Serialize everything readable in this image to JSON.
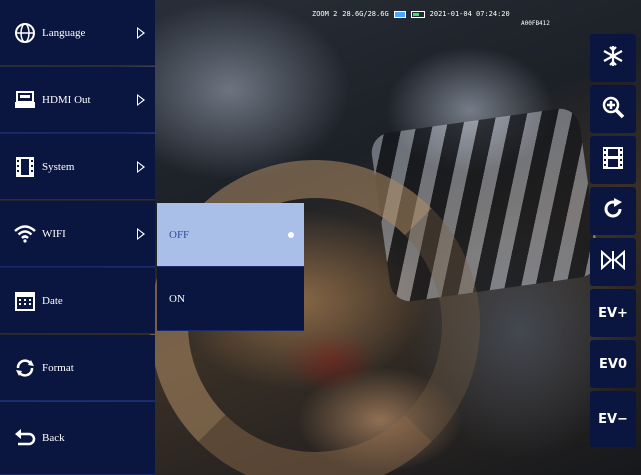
{
  "status": {
    "zoom": "ZOOM 2",
    "storage": "28.6G/28.6G",
    "datetime": "2021-01-04 07:24:20",
    "sub": "A00FB412"
  },
  "menu": {
    "items": [
      {
        "label": "Language",
        "icon": "globe-icon",
        "has_submenu": true
      },
      {
        "label": "HDMI Out",
        "icon": "hdmi-icon",
        "has_submenu": true
      },
      {
        "label": "System",
        "icon": "film-strip-icon",
        "has_submenu": true
      },
      {
        "label": "WIFI",
        "icon": "wifi-icon",
        "has_submenu": true
      },
      {
        "label": "Date",
        "icon": "calendar-icon",
        "has_submenu": false
      },
      {
        "label": "Format",
        "icon": "format-icon",
        "has_submenu": false
      },
      {
        "label": "Back",
        "icon": "back-arrow-icon",
        "has_submenu": false
      }
    ]
  },
  "submenu": {
    "options": [
      {
        "label": "OFF",
        "selected": true
      },
      {
        "label": "ON",
        "selected": false
      }
    ]
  },
  "toolbar": {
    "buttons": [
      {
        "icon": "snowflake-icon",
        "label": ""
      },
      {
        "icon": "zoom-in-icon",
        "label": ""
      },
      {
        "icon": "film-icon",
        "label": ""
      },
      {
        "icon": "rotate-icon",
        "label": ""
      },
      {
        "icon": "flip-icon",
        "label": ""
      },
      {
        "icon": "ev-plus",
        "label": "EV+"
      },
      {
        "icon": "ev-zero",
        "label": "EV0"
      },
      {
        "icon": "ev-minus",
        "label": "EV−"
      }
    ]
  },
  "colors": {
    "menu_bg": "#0a1540",
    "selected_bg": "#a9bfe8",
    "selected_text": "#2e4f9a"
  }
}
